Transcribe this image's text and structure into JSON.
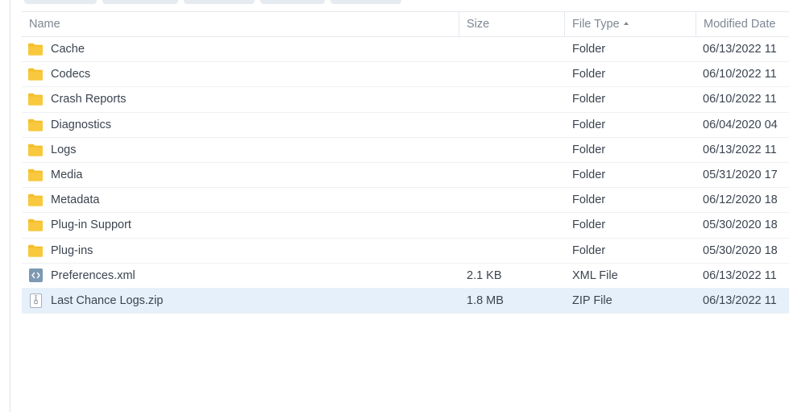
{
  "table": {
    "headers": {
      "name": "Name",
      "size": "Size",
      "file_type": "File Type",
      "modified": "Modified Date"
    },
    "sort_column": "file_type",
    "sort_direction": "ascending",
    "rows": [
      {
        "name": "Cache",
        "size": "",
        "type": "Folder",
        "modified": "06/13/2022 11",
        "icon": "folder-icon"
      },
      {
        "name": "Codecs",
        "size": "",
        "type": "Folder",
        "modified": "06/10/2022 11",
        "icon": "folder-icon"
      },
      {
        "name": "Crash Reports",
        "size": "",
        "type": "Folder",
        "modified": "06/10/2022 11",
        "icon": "folder-icon"
      },
      {
        "name": "Diagnostics",
        "size": "",
        "type": "Folder",
        "modified": "06/04/2020 04",
        "icon": "folder-icon"
      },
      {
        "name": "Logs",
        "size": "",
        "type": "Folder",
        "modified": "06/13/2022 11",
        "icon": "folder-icon"
      },
      {
        "name": "Media",
        "size": "",
        "type": "Folder",
        "modified": "05/31/2020 17",
        "icon": "folder-icon"
      },
      {
        "name": "Metadata",
        "size": "",
        "type": "Folder",
        "modified": "06/12/2020 18",
        "icon": "folder-icon"
      },
      {
        "name": "Plug-in Support",
        "size": "",
        "type": "Folder",
        "modified": "05/30/2020 18",
        "icon": "folder-icon"
      },
      {
        "name": "Plug-ins",
        "size": "",
        "type": "Folder",
        "modified": "05/30/2020 18",
        "icon": "folder-icon"
      },
      {
        "name": "Preferences.xml",
        "size": "2.1 KB",
        "type": "XML File",
        "modified": "06/13/2022 11",
        "icon": "xml-file-icon"
      },
      {
        "name": "Last Chance Logs.zip",
        "size": "1.8 MB",
        "type": "ZIP File",
        "modified": "06/13/2022 11",
        "icon": "zip-file-icon",
        "selected": true
      }
    ]
  },
  "colors": {
    "folder": "#f5bf2a",
    "xml_icon": "#7d99b3",
    "selected_row": "#e5f0fb"
  }
}
